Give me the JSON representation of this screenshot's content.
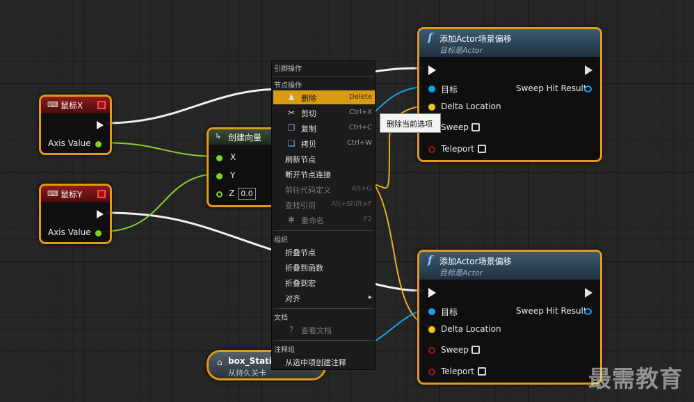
{
  "nodes": {
    "mouse_x": {
      "title": "鼠标X",
      "axis_label": "Axis Value"
    },
    "mouse_y": {
      "title": "鼠标Y",
      "axis_label": "Axis Value"
    },
    "make_vector": {
      "title": "创建向量",
      "pin_x": "X",
      "pin_y": "Y",
      "pin_z": "Z",
      "z_value": "0.0"
    },
    "add_offset_1": {
      "title": "添加Actor场景偏移",
      "subtitle": "目标是Actor",
      "target": "目标",
      "delta": "Delta Location",
      "sweep": "Sweep",
      "teleport": "Teleport",
      "sweep_hit": "Sweep Hit Result"
    },
    "add_offset_2": {
      "title": "添加Actor场景偏移",
      "subtitle": "目标是Actor",
      "target": "目标",
      "delta": "Delta Location",
      "sweep": "Sweep",
      "teleport": "Teleport",
      "sweep_hit": "Sweep Hit Result"
    },
    "box_static": {
      "title": "box_Static",
      "subtitle": "从持久关卡"
    }
  },
  "context_menu": {
    "sections": {
      "pin_actions": "引脚操作",
      "node_actions": "节点操作",
      "organize": "组织",
      "docs": "文档",
      "comment_group": "注释组"
    },
    "items": {
      "delete": {
        "label": "删除",
        "shortcut": "Delete"
      },
      "cut": {
        "label": "剪切",
        "shortcut": "Ctrl+X"
      },
      "copy": {
        "label": "复制",
        "shortcut": "Ctrl+C"
      },
      "duplicate": {
        "label": "拷贝",
        "shortcut": "Ctrl+W"
      },
      "refresh": {
        "label": "刷新节点"
      },
      "break_links": {
        "label": "断开节点连接"
      },
      "goto_def": {
        "label": "前往代码定义",
        "shortcut": "Alt+G"
      },
      "find_refs": {
        "label": "查找引用",
        "shortcut": "Alt+Shift+F"
      },
      "rename": {
        "label": "重命名",
        "shortcut": "F2"
      },
      "collapse_node": {
        "label": "折叠节点"
      },
      "collapse_func": {
        "label": "折叠到函数"
      },
      "collapse_macro": {
        "label": "折叠到宏"
      },
      "align": {
        "label": "对齐"
      },
      "view_docs": {
        "label": "查看文档"
      },
      "create_comment": {
        "label": "从选中项创建注释"
      }
    }
  },
  "tooltip": "删除当前选项",
  "watermark": "最需教育",
  "colors": {
    "selection": "#e39a14",
    "highlight": "#d99a14",
    "float_pin": "#7ed321",
    "object_pin": "#1aa0e8",
    "vector_pin": "#f5c31a",
    "bool_pin": "#8b1010"
  },
  "icons": {
    "mouse": "mouse-icon",
    "function": "function-icon",
    "struct": "struct-icon",
    "delete": "delete-icon",
    "cut": "scissors-icon",
    "copy": "copy-icon",
    "duplicate": "duplicate-icon",
    "rename": "rename-icon",
    "help": "help-icon"
  }
}
